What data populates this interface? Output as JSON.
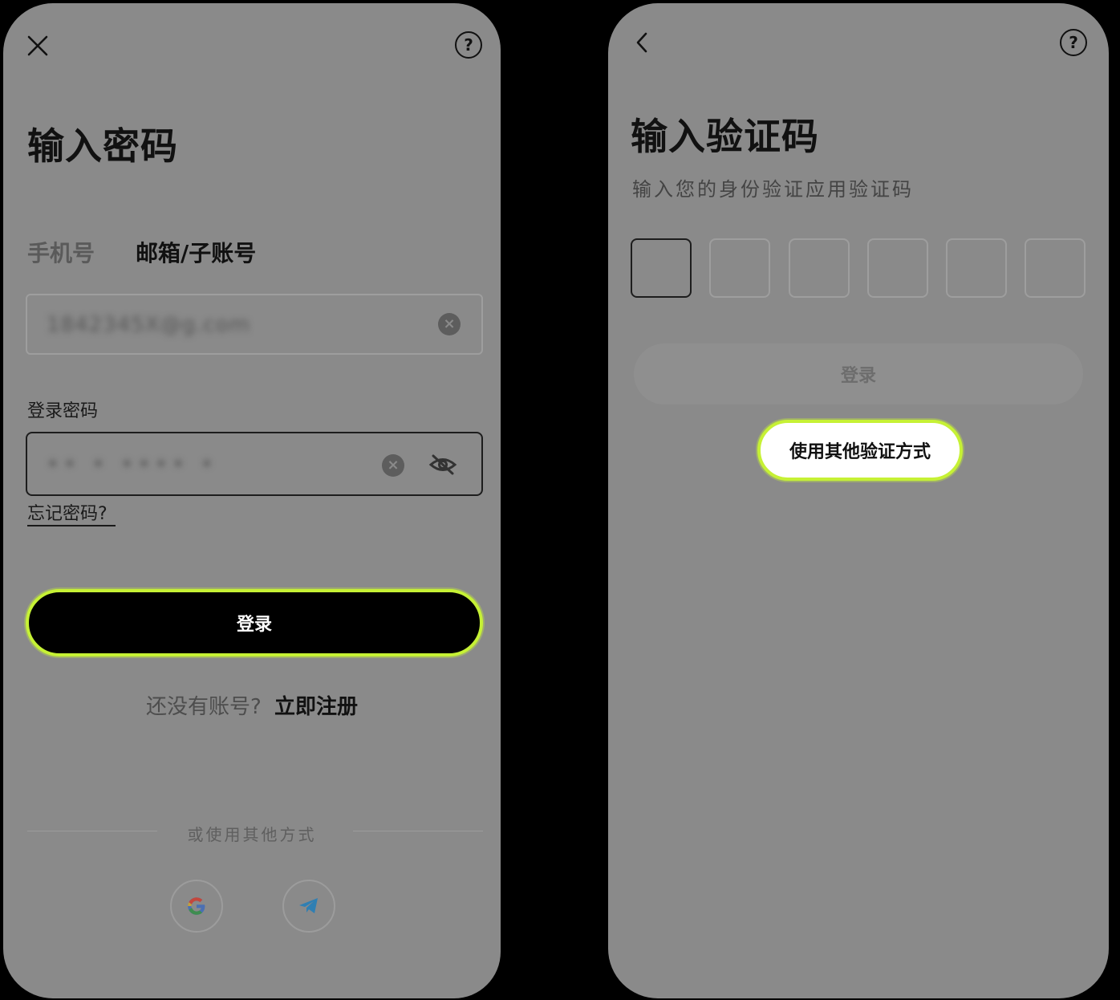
{
  "left": {
    "title": "输入密码",
    "tabs": [
      {
        "label": "手机号",
        "active": false
      },
      {
        "label": "邮箱/子账号",
        "active": true
      }
    ],
    "account_field": {
      "value": "1842345X@g.com"
    },
    "password_label": "登录密码",
    "password_field": {
      "value": "•• • •••• •"
    },
    "forgot_link": "忘记密码?",
    "login_button": "登录",
    "register_prompt": "还没有账号?",
    "register_link": "立即注册",
    "divider_text": "或使用其他方式",
    "social": [
      {
        "icon": "google-icon"
      },
      {
        "icon": "telegram-icon"
      }
    ]
  },
  "right": {
    "title": "输入验证码",
    "subtitle": "输入您的身份验证应用验证码",
    "otp_length": 6,
    "login_button": "登录",
    "alt_method_button": "使用其他验证方式"
  },
  "colors": {
    "highlight": "#c6f135",
    "screen_bg": "#8a8a8a",
    "primary": "#000000"
  }
}
